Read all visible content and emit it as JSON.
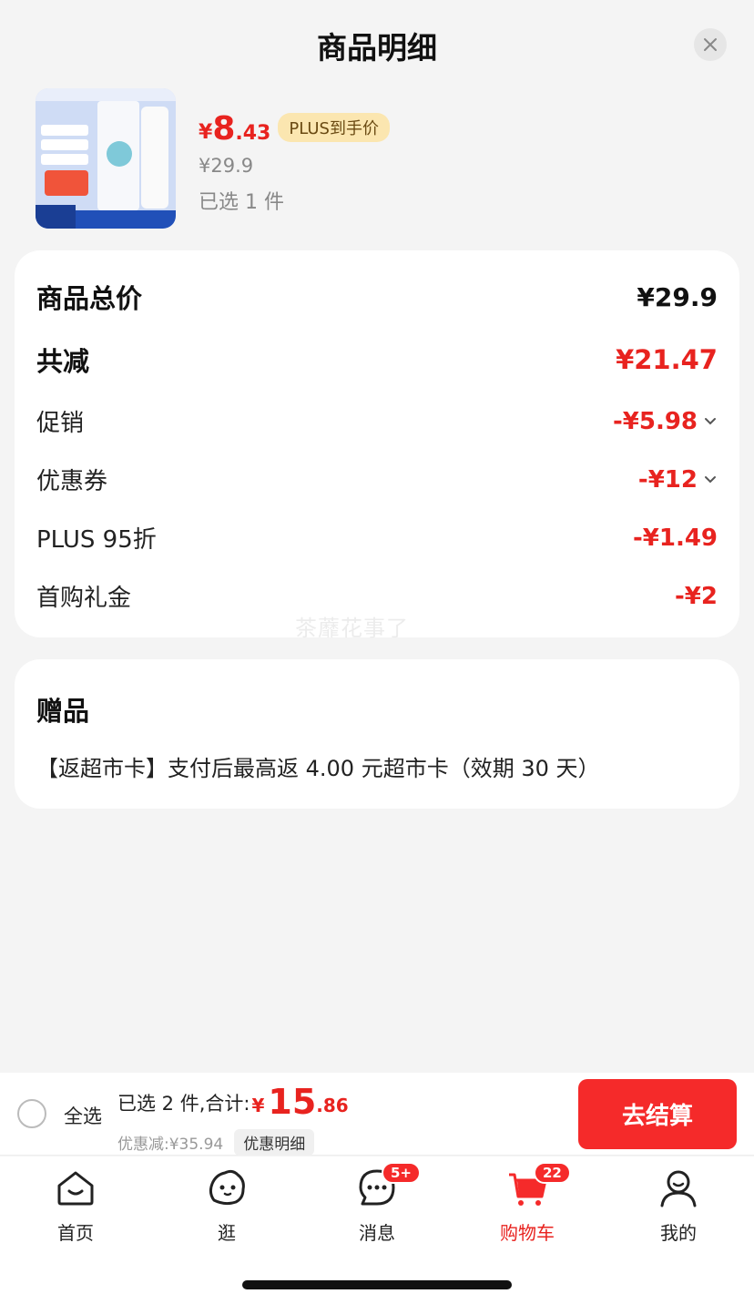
{
  "sheet": {
    "title": "商品明细",
    "close_icon": "close-icon"
  },
  "product": {
    "image_icon": "toothpaste-product-image",
    "price_symbol": "¥",
    "price_int": "8",
    "price_dec": ".43",
    "plus_badge": "PLUS到手价",
    "original_price": "¥29.9",
    "selected": "已选 1 件"
  },
  "summary": {
    "total_label": "商品总价",
    "total_value": "¥29.9",
    "reduce_label": "共减",
    "reduce_value": "¥21.47",
    "items": [
      {
        "label": "促销",
        "value": "-¥5.98",
        "expandable": true
      },
      {
        "label": "优惠券",
        "value": "-¥12",
        "expandable": true
      },
      {
        "label": "PLUS 95折",
        "value": "-¥1.49",
        "expandable": false
      },
      {
        "label": "首购礼金",
        "value": "-¥2",
        "expandable": false
      }
    ],
    "watermark": "茶蘼花事了"
  },
  "gift": {
    "title": "赠品",
    "desc": "【返超市卡】支付后最高返 4.00 元超市卡（效期 30 天）"
  },
  "checkout": {
    "select_all": "全选",
    "total_label": "已选 2 件,合计:",
    "total_symbol": "¥",
    "total_int": "15",
    "total_dec": ".86",
    "discount": "优惠减:¥35.94",
    "detail_button": "优惠明细",
    "button": "去结算"
  },
  "tabs": [
    {
      "label": "首页",
      "icon": "home-icon"
    },
    {
      "label": "逛",
      "icon": "explore-icon"
    },
    {
      "label": "消息",
      "icon": "message-icon",
      "badge": "5+"
    },
    {
      "label": "购物车",
      "icon": "cart-icon",
      "badge": "22",
      "active": true
    },
    {
      "label": "我的",
      "icon": "profile-icon"
    }
  ],
  "colors": {
    "accent": "#e8231f",
    "button": "#f52a2a",
    "plus_badge_bg": "#fbe6b0"
  }
}
